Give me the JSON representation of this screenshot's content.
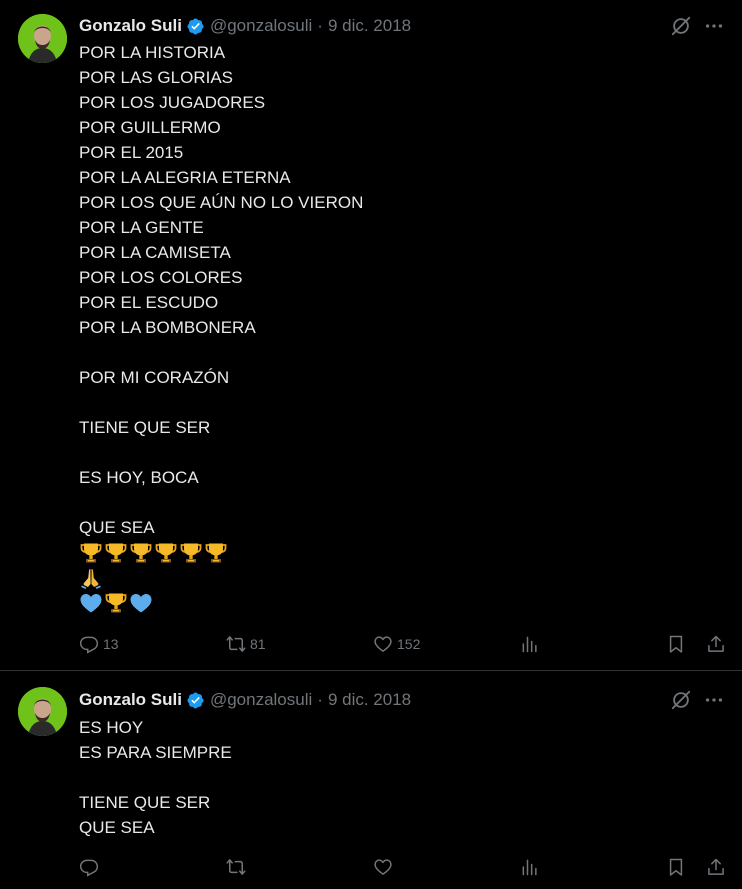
{
  "colors": {
    "background": "#000000",
    "text": "#e7e9ea",
    "muted": "#71767b",
    "verified": "#1d9bf0",
    "avatar_bg": "#6fc21a",
    "divider": "#2f3336"
  },
  "tweets": [
    {
      "author": {
        "name": "Gonzalo Suli",
        "handle": "@gonzalosuli",
        "verified_icon": "verified-badge-icon"
      },
      "separator": "·",
      "date": "9 dic. 2018",
      "lines": [
        "POR LA HISTORIA",
        "POR LAS GLORIAS",
        "POR LOS JUGADORES",
        "POR GUILLERMO",
        "POR EL 2015",
        "POR LA ALEGRIA ETERNA",
        "POR LOS QUE AÚN NO LO VIERON",
        "POR LA GENTE",
        "POR LA CAMISETA",
        "POR LOS COLORES",
        "POR EL ESCUDO",
        "POR LA BOMBONERA",
        "",
        "POR MI CORAZÓN",
        "",
        "TIENE QUE SER",
        "",
        "ES HOY, BOCA",
        "",
        "QUE SEA"
      ],
      "emoji_lines": [
        [
          "trophy",
          "trophy",
          "trophy",
          "trophy",
          "trophy",
          "trophy"
        ],
        [
          "folded-hands"
        ],
        [
          "blue-heart",
          "trophy",
          "blue-heart"
        ]
      ],
      "stats": {
        "replies": "13",
        "retweets": "81",
        "likes": "152",
        "views": ""
      }
    },
    {
      "author": {
        "name": "Gonzalo Suli",
        "handle": "@gonzalosuli",
        "verified_icon": "verified-badge-icon"
      },
      "separator": "·",
      "date": "9 dic. 2018",
      "lines": [
        "ES HOY",
        "ES PARA SIEMPRE",
        "",
        "TIENE QUE SER",
        "QUE SEA"
      ],
      "emoji_lines": [],
      "stats": {
        "replies": "",
        "retweets": "",
        "likes": "",
        "views": ""
      }
    }
  ]
}
